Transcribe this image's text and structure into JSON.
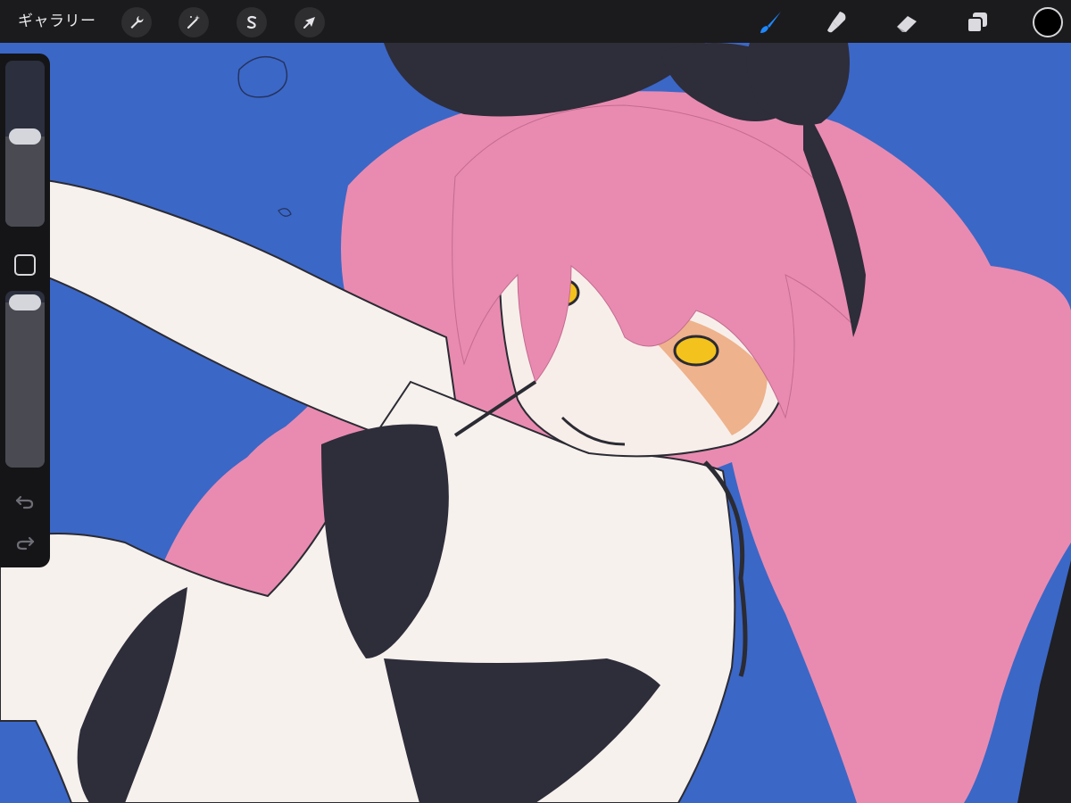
{
  "toolbar": {
    "gallery_label": "ギャラリー",
    "left_tools": [
      "actions-wrench-icon",
      "adjustments-wand-icon",
      "selection-s-icon",
      "transform-arrow-icon"
    ],
    "right_tools": [
      "brush-icon",
      "smudge-icon",
      "eraser-icon",
      "layers-icon"
    ],
    "active_tool": "brush-icon",
    "active_color": "#000000",
    "accent_color": "#1e88ff"
  },
  "sidebar": {
    "brush_size": 0.55,
    "brush_opacity": 1.0,
    "icons": [
      "modify-square-icon",
      "undo-icon",
      "redo-icon"
    ]
  },
  "canvas": {
    "background_color": "#3b67c7",
    "hair_color": "#e98bb0",
    "skin_color": "#f7f1ee",
    "swimsuit_color": "#2e2d3a",
    "eye_color": "#f4c21c"
  }
}
